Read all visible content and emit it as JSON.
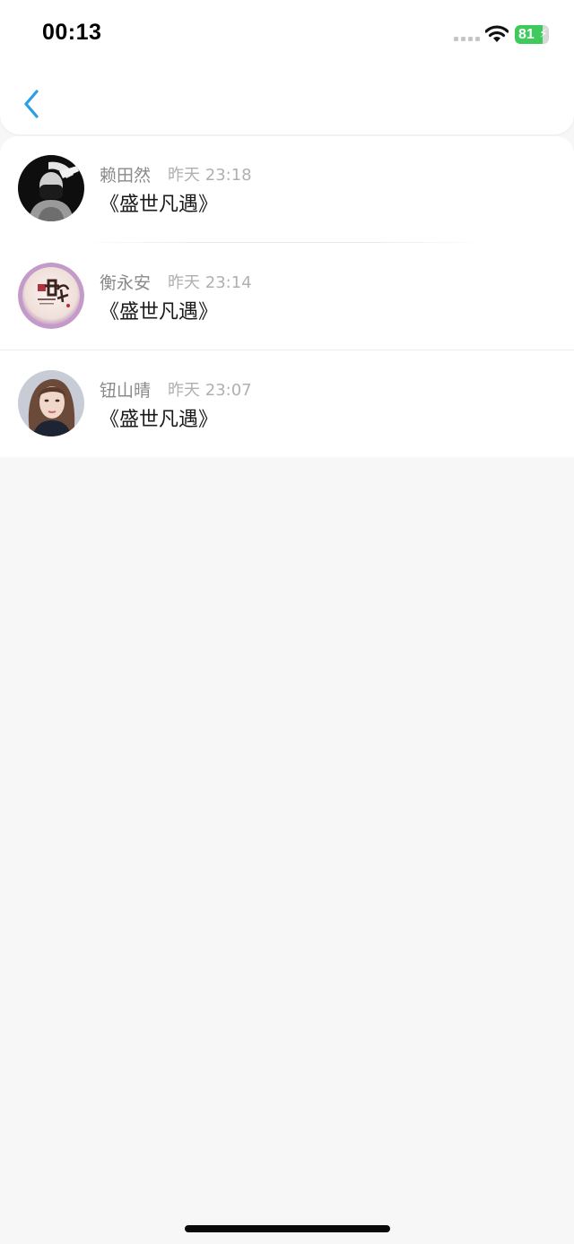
{
  "status_bar": {
    "time": "00:13",
    "battery_level": "81",
    "battery_color": "#3ecb5b"
  },
  "nav": {
    "back_icon": "chevron-left-icon",
    "accent_color": "#2b9ee6"
  },
  "messages": [
    {
      "name": "赖田然",
      "time": "昨天 23:18",
      "content": "《盛世凡遇》",
      "avatar": "dark-masked-person"
    },
    {
      "name": "衡永安",
      "time": "昨天 23:14",
      "content": "《盛世凡遇》",
      "avatar": "mid-autumn-mooncake"
    },
    {
      "name": "钮山晴",
      "time": "昨天 23:07",
      "content": "《盛世凡遇》",
      "avatar": "young-woman-portrait"
    }
  ]
}
